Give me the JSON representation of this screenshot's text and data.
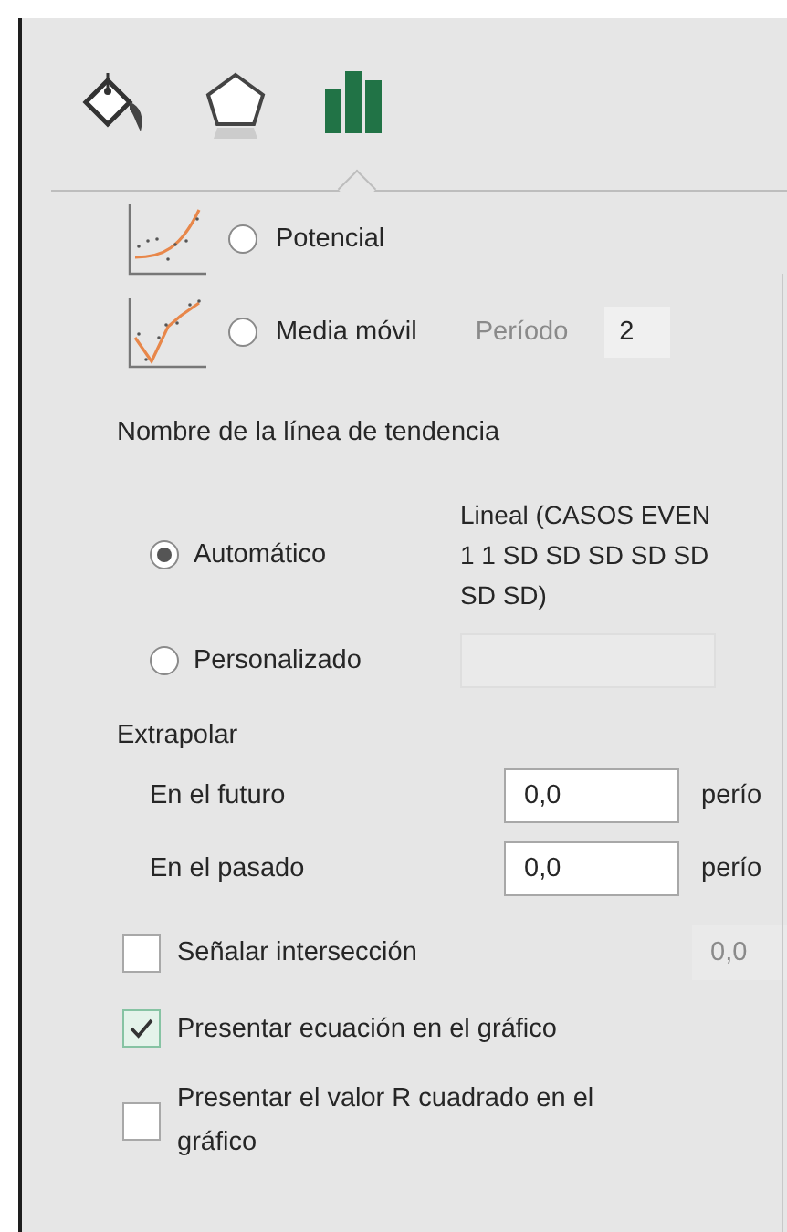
{
  "tabs": [
    {
      "kind": "fill",
      "selected": false
    },
    {
      "kind": "effects",
      "selected": false
    },
    {
      "kind": "series",
      "selected": true
    }
  ],
  "trend_types": [
    {
      "kind": "power",
      "label": "Potencial",
      "selected": false
    },
    {
      "kind": "moving-average",
      "label": "Media móvil",
      "selected": false,
      "period_label": "Período",
      "period_value": "2",
      "disabled": true
    }
  ],
  "name_section": {
    "heading": "Nombre de la línea de tendencia",
    "options": [
      {
        "kind": "auto",
        "label": "Automático",
        "selected": true,
        "value_lines": [
          "Lineal (CASOS EVEN",
          "1 1 SD SD SD SD SD",
          "SD SD)"
        ]
      },
      {
        "kind": "custom",
        "label": "Personalizado",
        "selected": false
      }
    ]
  },
  "extrapolate": {
    "heading": "Extrapolar",
    "rows": [
      {
        "label": "En el futuro",
        "value": "0,0",
        "unit": "perío"
      },
      {
        "label": "En el pasado",
        "value": "0,0",
        "unit": "perío"
      }
    ]
  },
  "options": [
    {
      "label": "Señalar intersección",
      "checked": false,
      "value": "0,0"
    },
    {
      "label": "Presentar ecuación en el gráfico",
      "checked": true
    },
    {
      "label": "Presentar el valor R cuadrado en el gráfico",
      "checked": false
    }
  ]
}
